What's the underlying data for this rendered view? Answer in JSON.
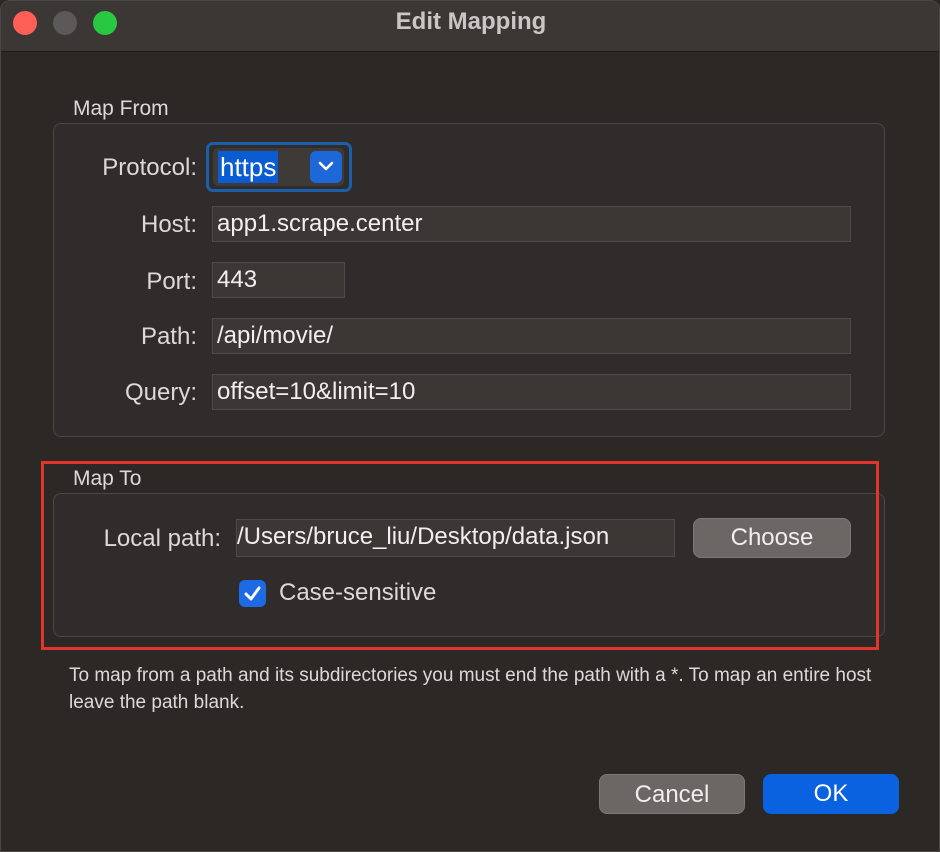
{
  "window": {
    "title": "Edit Mapping"
  },
  "map_from": {
    "group_label": "Map From",
    "protocol": {
      "label": "Protocol:",
      "value": "https",
      "icon": "chevron-down-icon"
    },
    "host": {
      "label": "Host:",
      "value": "app1.scrape.center"
    },
    "port": {
      "label": "Port:",
      "value": "443"
    },
    "path": {
      "label": "Path:",
      "value": "/api/movie/"
    },
    "query": {
      "label": "Query:",
      "value": "offset=10&limit=10"
    }
  },
  "map_to": {
    "group_label": "Map To",
    "local_path": {
      "label": "Local path:",
      "value": "/Users/bruce_liu/Desktop/data.json"
    },
    "choose_label": "Choose",
    "case_sensitive": {
      "label": "Case-sensitive",
      "checked": true
    }
  },
  "hint": "To map from a path and its subdirectories you must end the path with a *. To map an entire host leave the path blank.",
  "buttons": {
    "cancel": "Cancel",
    "ok": "OK"
  },
  "colors": {
    "accent": "#0a62e0",
    "annotation": "#e3342b",
    "close": "#ff5f57",
    "zoom": "#28c840"
  }
}
